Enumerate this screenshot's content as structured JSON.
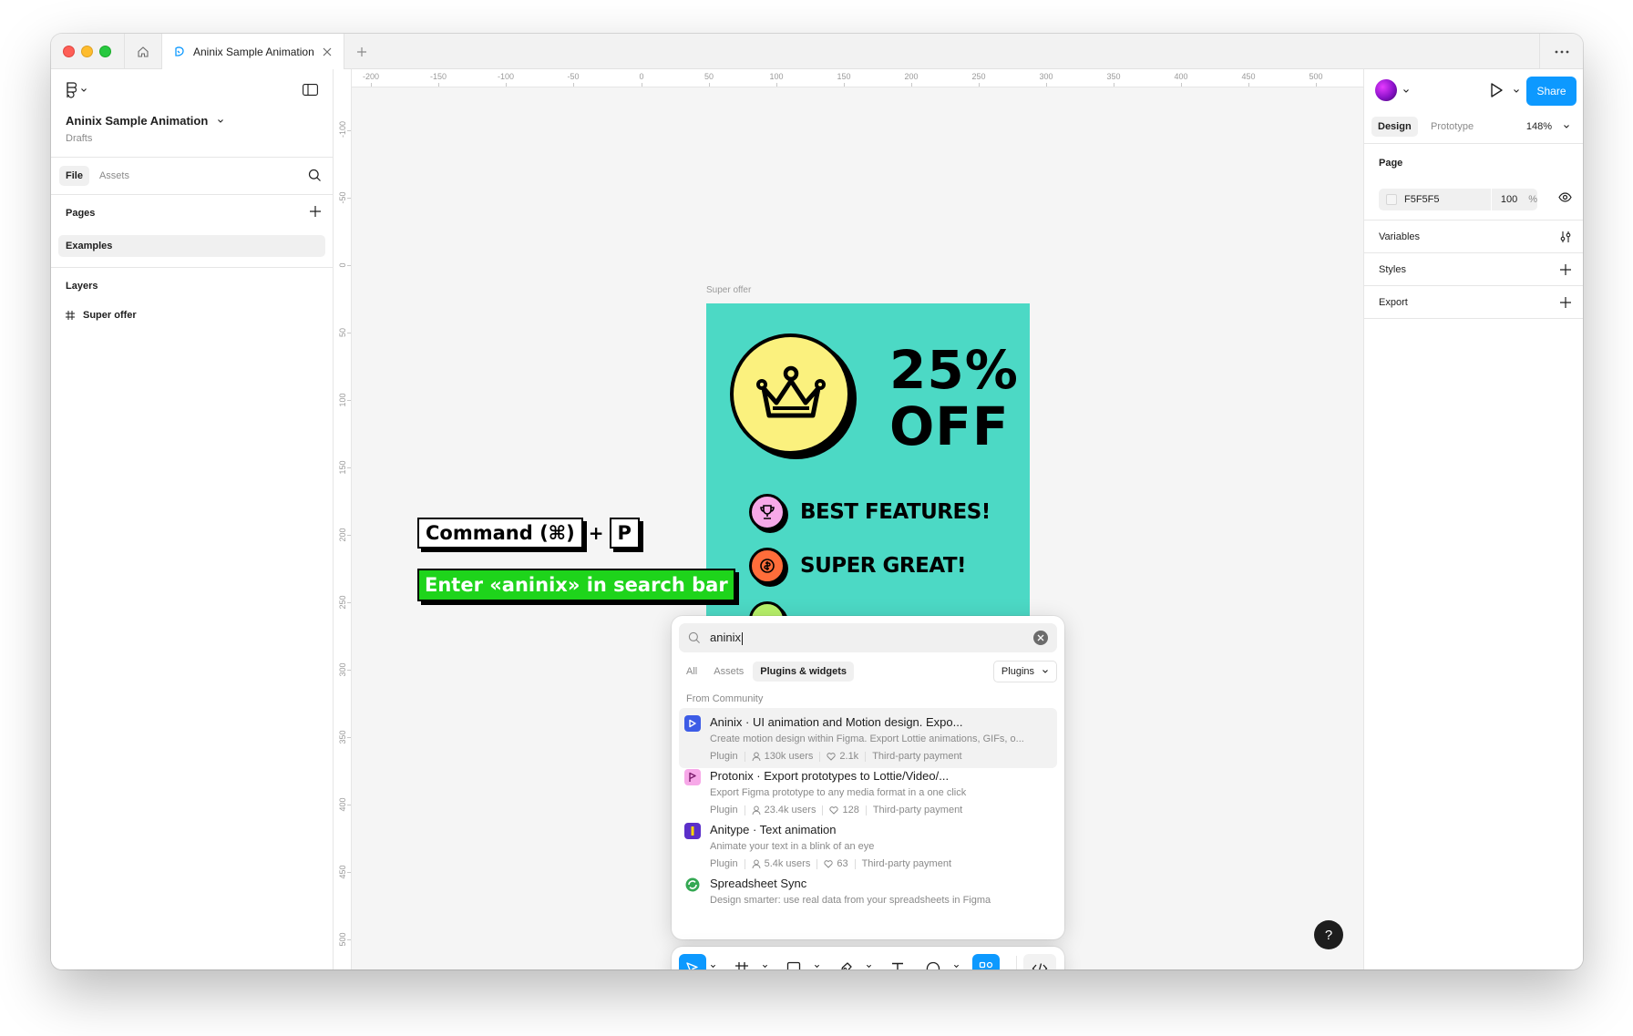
{
  "tabs": {
    "active_title": "Aninix Sample Animation"
  },
  "left_panel": {
    "file_name": "Aninix Sample Animation",
    "file_location": "Drafts",
    "tabs": [
      "File",
      "Assets"
    ],
    "pages_title": "Pages",
    "pages": [
      "Examples"
    ],
    "layers_title": "Layers",
    "layers": [
      "Super offer"
    ]
  },
  "rulers": {
    "top": [
      "-200",
      "-150",
      "-100",
      "-50",
      "0",
      "50",
      "100",
      "150",
      "200",
      "250",
      "300",
      "350",
      "400",
      "450",
      "500"
    ],
    "left": [
      "-100",
      "-50",
      "0",
      "50",
      "100",
      "150",
      "200",
      "250",
      "300",
      "350",
      "400",
      "450",
      "500"
    ]
  },
  "canvas": {
    "frame_label": "Super offer",
    "offer_line1": "25%",
    "offer_line2": "OFF",
    "feature1": "BEST FEATURES!",
    "feature2": "SUPER GREAT!",
    "hint_key_command": "Command (⌘)",
    "hint_plus": "+",
    "hint_key_p": "P",
    "hint_search": "Enter «aninix» in search bar",
    "colors": {
      "frame_bg": "#4cd9c5",
      "crown_bg": "#fbf17e",
      "feature1_dot": "#f7a8e8",
      "feature2_dot": "#ff6d3a",
      "feature3_dot": "#b8f26a",
      "hint_green": "#1ed41b"
    }
  },
  "search": {
    "query": "aninix",
    "filters": [
      "All",
      "Assets",
      "Plugins & widgets"
    ],
    "active_filter": "Plugins & widgets",
    "type_select": "Plugins",
    "section": "From Community",
    "results": [
      {
        "title": "Aninix · UI animation and Motion design. Expo...",
        "desc": "Create motion design within Figma. Export Lottie animations, GIFs, o...",
        "type": "Plugin",
        "users": "130k users",
        "likes": "2.1k",
        "pricing": "Third-party payment",
        "icon": "aninix-icon",
        "icon_color": "#3d5ce6"
      },
      {
        "title": "Protonix · Export prototypes to Lottie/Video/...",
        "desc": "Export Figma prototype to any media format in a one click",
        "type": "Plugin",
        "users": "23.4k users",
        "likes": "128",
        "pricing": "Third-party payment",
        "icon": "protonix-icon",
        "icon_color": "#f7a8e8"
      },
      {
        "title": "Anitype · Text animation",
        "desc": "Animate your text in a blink of an eye",
        "type": "Plugin",
        "users": "5.4k users",
        "likes": "63",
        "pricing": "Third-party payment",
        "icon": "anitype-icon",
        "icon_color": "#5b2fc9"
      },
      {
        "title": "Spreadsheet Sync",
        "desc": "Design smarter: use real data from your spreadsheets in Figma",
        "type": "",
        "users": "",
        "likes": "",
        "pricing": "",
        "icon": "spreadsheet-sync-icon",
        "icon_color": "#34a853"
      }
    ]
  },
  "right_panel": {
    "share_label": "Share",
    "tabs": [
      "Design",
      "Prototype"
    ],
    "zoom": "148%",
    "page_title": "Page",
    "page_color": "F5F5F5",
    "page_opacity": "100",
    "opacity_unit": "%",
    "variables_title": "Variables",
    "styles_title": "Styles",
    "export_title": "Export",
    "accent_color": "#0d99ff"
  },
  "help_label": "?"
}
